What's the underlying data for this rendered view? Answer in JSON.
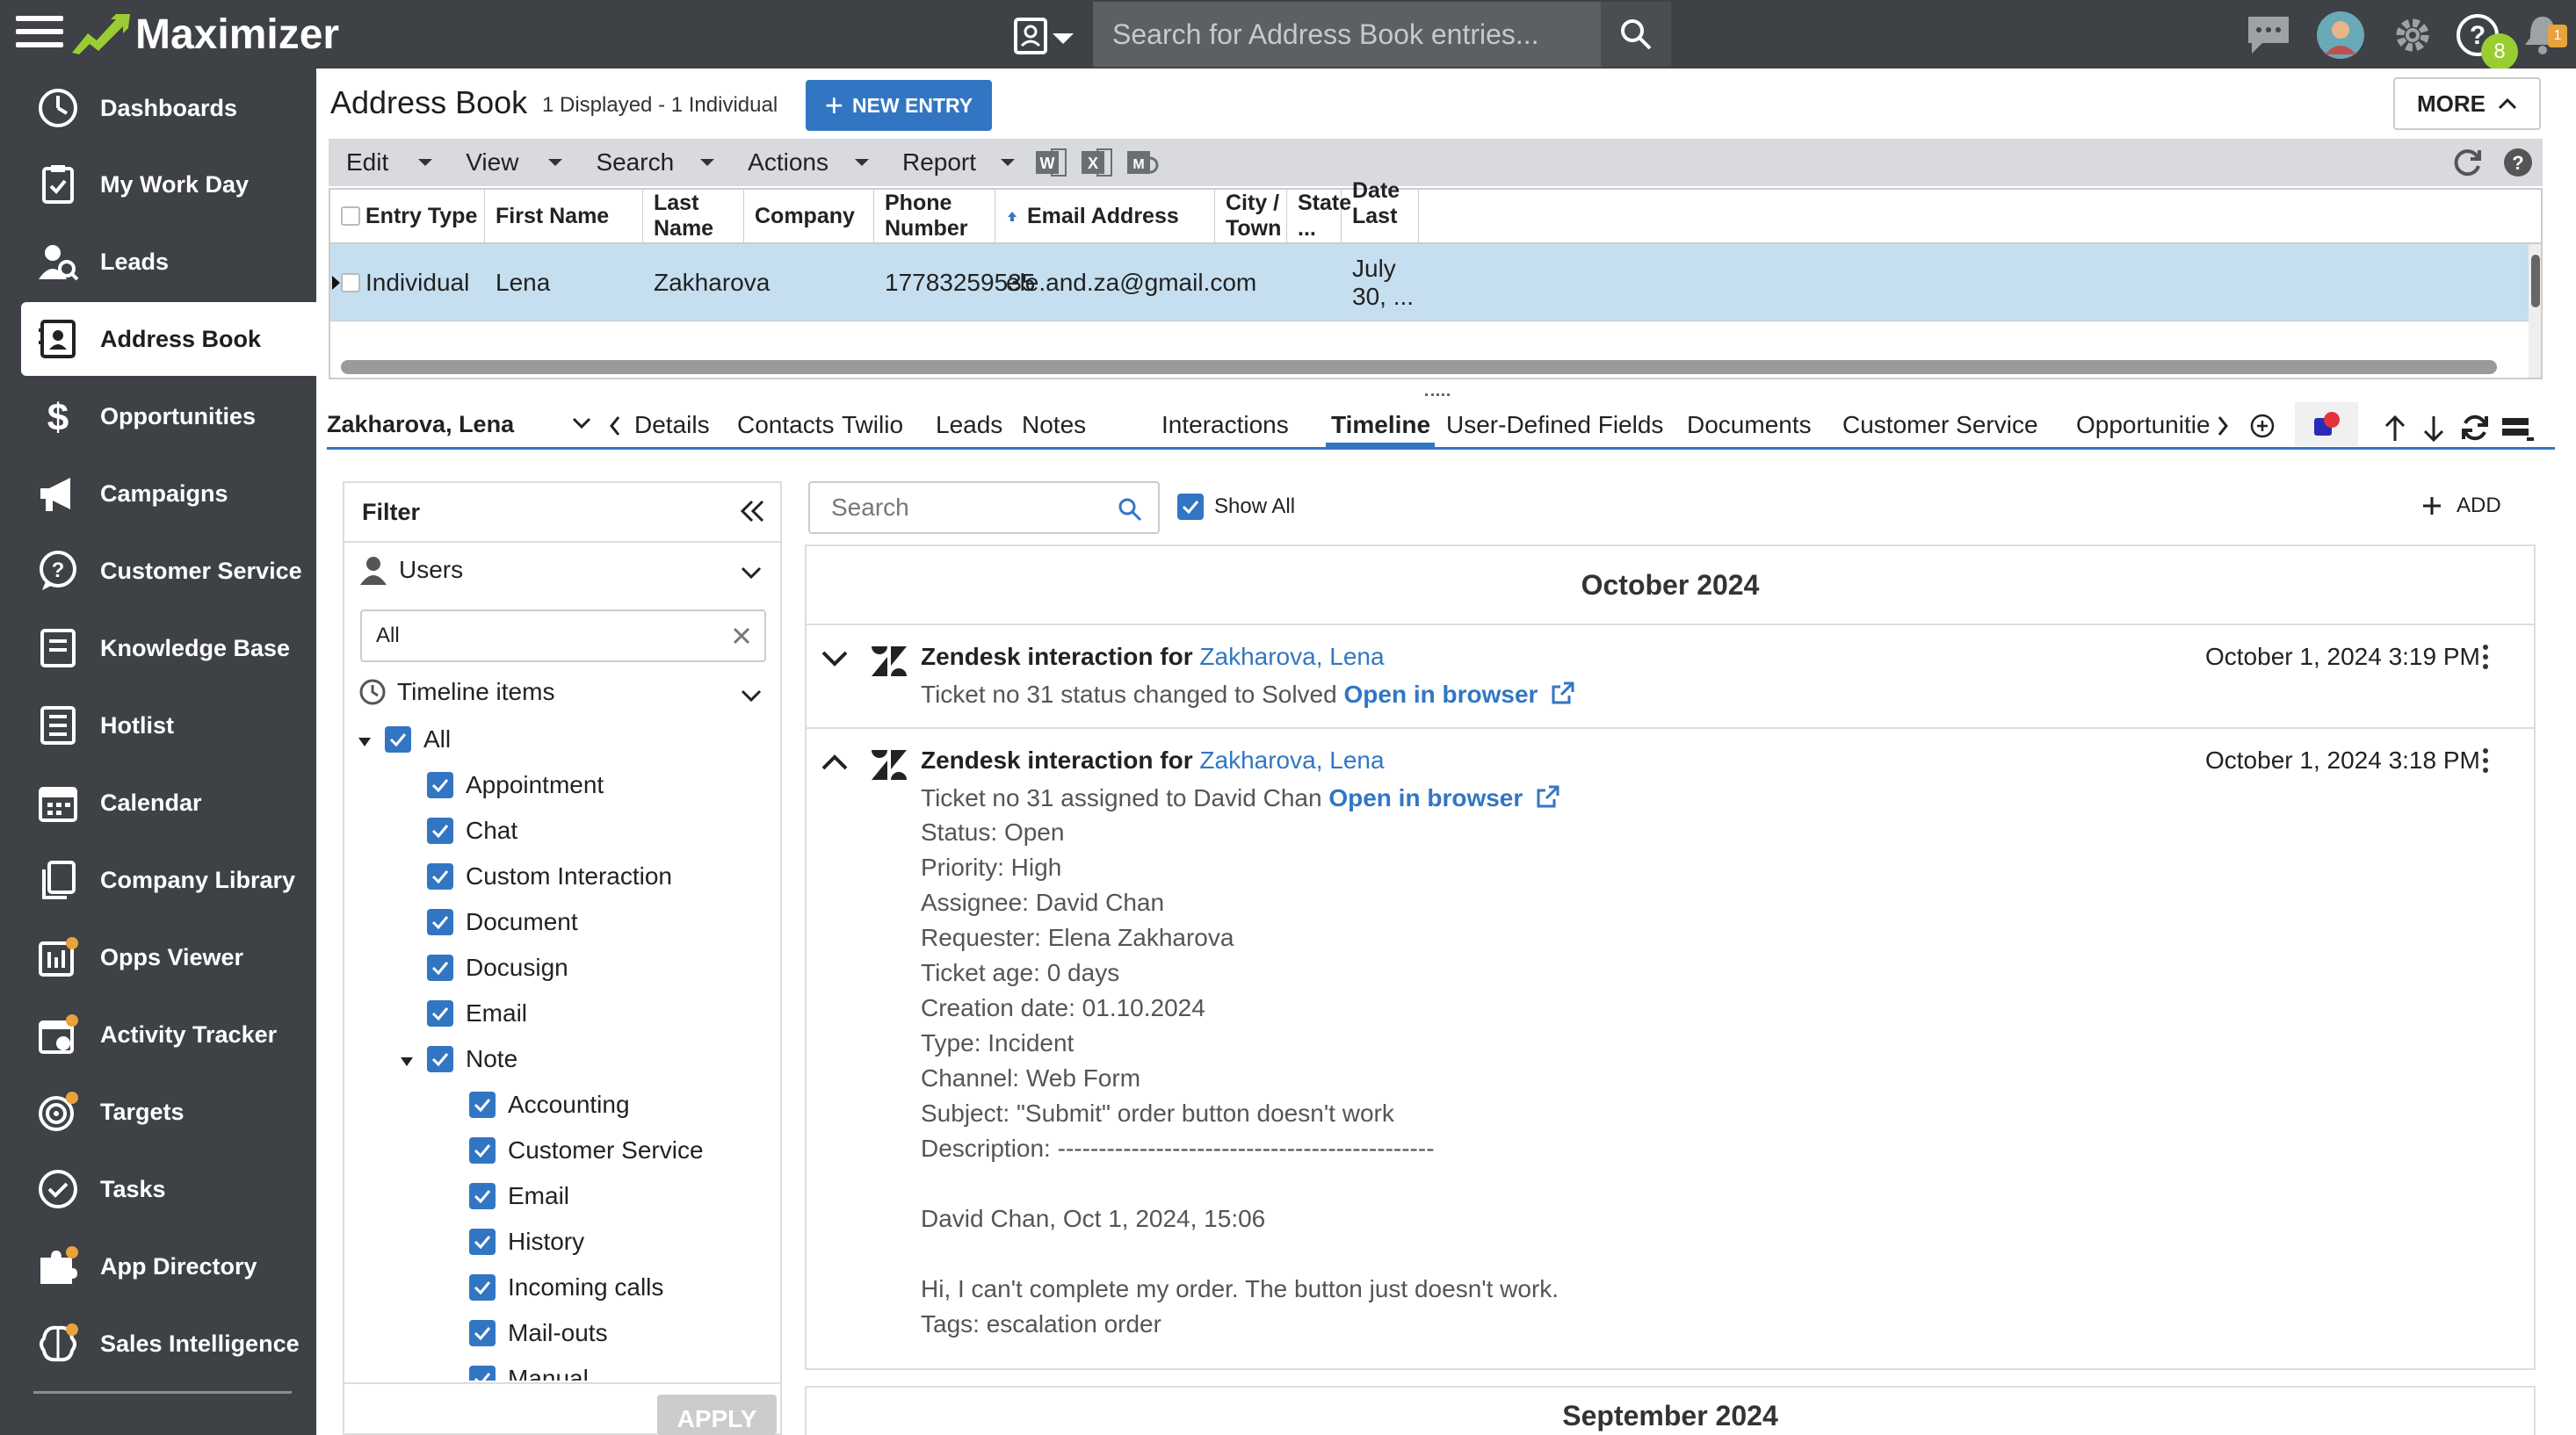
{
  "app": {
    "name": "Maximizer"
  },
  "header": {
    "search_placeholder": "Search for Address Book entries...",
    "notification_count": "8",
    "alert_count": "1"
  },
  "sidebar": {
    "items": [
      {
        "label": "Dashboards",
        "icon": "dashboard-icon"
      },
      {
        "label": "My Work Day",
        "icon": "clipboard-icon"
      },
      {
        "label": "Leads",
        "icon": "leads-icon"
      },
      {
        "label": "Address Book",
        "icon": "address-book-icon"
      },
      {
        "label": "Opportunities",
        "icon": "dollar-icon"
      },
      {
        "label": "Campaigns",
        "icon": "megaphone-icon"
      },
      {
        "label": "Customer Service",
        "icon": "help-bubble-icon"
      },
      {
        "label": "Knowledge Base",
        "icon": "book-icon"
      },
      {
        "label": "Hotlist",
        "icon": "list-icon"
      },
      {
        "label": "Calendar",
        "icon": "calendar-icon"
      },
      {
        "label": "Company Library",
        "icon": "library-icon"
      },
      {
        "label": "Opps Viewer",
        "icon": "opps-viewer-icon"
      },
      {
        "label": "Activity Tracker",
        "icon": "activity-tracker-icon"
      },
      {
        "label": "Targets",
        "icon": "target-icon"
      },
      {
        "label": "Tasks",
        "icon": "check-circle-icon"
      },
      {
        "label": "App Directory",
        "icon": "puzzle-icon"
      },
      {
        "label": "Sales Intelligence",
        "icon": "brain-icon"
      }
    ],
    "active": "Address Book"
  },
  "address_book": {
    "title": "Address Book",
    "count": "1 Displayed - 1 Individual",
    "new_entry": "NEW ENTRY",
    "more": "MORE"
  },
  "menu": {
    "edit": "Edit",
    "view": "View",
    "search": "Search",
    "actions": "Actions",
    "report": "Report"
  },
  "grid": {
    "columns": [
      "Entry Type",
      "First Name",
      "Last Name",
      "Company",
      "Phone Number",
      "Email Address",
      "City / Town",
      "State ...",
      "Date Last ..."
    ],
    "rows": [
      {
        "entry_type": "Individual",
        "first_name": "Lena",
        "last_name": "Zakharova",
        "company": "",
        "phone": "17783259535",
        "email": "ele.and.za@gmail.com",
        "city": "",
        "state": "",
        "date_last": "July 30, ..."
      }
    ]
  },
  "detail": {
    "contact": "Zakharova, Lena",
    "tabs": [
      "Details",
      "Contacts",
      "Twilio",
      "Leads",
      "Notes",
      "Interactions",
      "Timeline",
      "User-Defined Fields",
      "Documents",
      "Customer Service",
      "Opportunitie"
    ],
    "active_tab": "Timeline"
  },
  "filter": {
    "title": "Filter",
    "users_label": "Users",
    "users_value": "All",
    "timeline_label": "Timeline items",
    "items": [
      "All",
      "Appointment",
      "Chat",
      "Custom Interaction",
      "Document",
      "Docusign",
      "Email",
      "Note",
      "Accounting",
      "Customer Service",
      "Email",
      "History",
      "Incoming calls",
      "Mail-outs",
      "Manual"
    ],
    "apply": "APPLY"
  },
  "timeline": {
    "search_placeholder": "Search",
    "show_all": "Show All",
    "add": "ADD",
    "month1": "October 2024",
    "month2": "September 2024",
    "entries": [
      {
        "title": "Zendesk interaction for",
        "contact": "Zakharova, Lena",
        "date": "October 1, 2024 3:19 PM",
        "line": "Ticket no 31 status changed to Solved",
        "link": "Open in browser"
      },
      {
        "title": "Zendesk interaction for",
        "contact": "Zakharova, Lena",
        "date": "October 1, 2024 3:18 PM",
        "line": "Ticket no 31 assigned to David Chan",
        "link": "Open in browser",
        "details": [
          "Status: Open",
          "Priority: High",
          "Assignee: David  Chan",
          "Requester: Elena Zakharova",
          "Ticket age: 0 days",
          "Creation date: 01.10.2024",
          "Type: Incident",
          "Channel: Web Form",
          "Subject: \"Submit\" order button doesn't work",
          "Description: ----------------------------------------------",
          "David  Chan, Oct 1, 2024, 15:06",
          "Hi, I can't complete my order. The button just doesn't work.",
          "Tags: escalation order"
        ]
      }
    ]
  },
  "colors": {
    "accent": "#3276c3",
    "sidebar_bg": "#3e4145",
    "selected_row": "#c6dff0",
    "logo_green": "#9acd32"
  }
}
